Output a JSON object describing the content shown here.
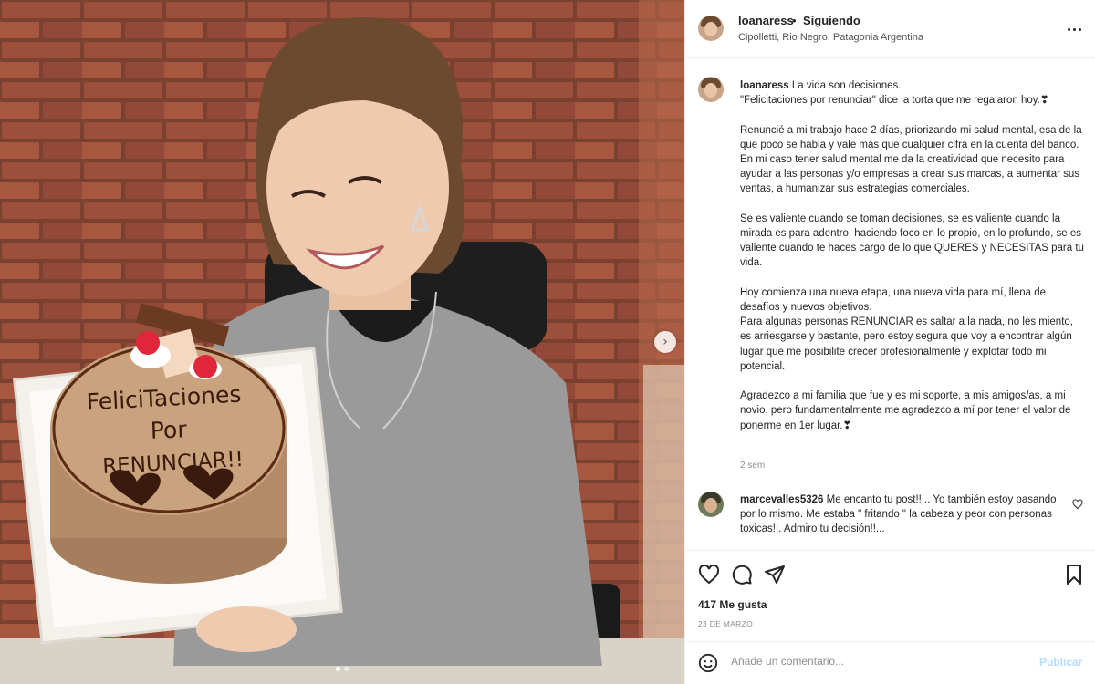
{
  "post": {
    "username": "loanaress",
    "separator": "•",
    "follow_status": "Siguiendo",
    "location": "Cipolletti, Rio Negro, Patagonia Argentina",
    "more_icon": "more-horizontal-icon"
  },
  "photo": {
    "cake_lines": [
      "FeliciTaciones",
      "Por",
      "RENUNCIAR!!"
    ],
    "next_icon": "chevron-right-icon",
    "carousel_count": 2,
    "carousel_active": 0
  },
  "caption": {
    "username": "loanaress",
    "lead": "La vida son decisiones.",
    "body": "\"Felicitaciones por renunciar\" dice la torta que me regalaron hoy.❣\n\nRenuncié a mi trabajo hace 2 días, priorizando mi salud mental, esa de la que poco se habla y vale más que cualquier cifra en la cuenta del banco.\nEn mi caso tener salud mental me da la creatividad que necesito para ayudar a las personas y/o empresas a crear sus marcas, a aumentar sus ventas, a humanizar sus estrategias comerciales.\n\nSe es valiente cuando se toman decisiones, se es valiente cuando la mirada es para adentro, haciendo foco en lo propio, en lo profundo, se es valiente cuando te haces cargo de lo que QUERES y NECESITAS para tu vida.\n\nHoy comienza una nueva etapa, una nueva vida para mí, llena de desafíos y nuevos objetivos.\nPara algunas personas RENUNCIAR es saltar a la nada, no les miento, es arriesgarse y bastante, pero estoy segura que voy a encontrar algún lugar que me posibilite crecer profesionalmente y explotar todo mi potencial.\n\nAgradezco a mi familia que fue y es mi soporte, a mis amigos/as, a mi novio, pero fundamentalmente me agradezco a mí por tener el valor de ponerme en 1er lugar.❣",
    "age": "2 sem"
  },
  "comment": {
    "username": "marcevalles5326",
    "text": "Me encanto tu post!!... Yo también estoy pasando por lo mismo. Me estaba \" fritando \" la cabeza y peor con personas toxicas!!. Admiro tu decisión!!..."
  },
  "actions": {
    "likes": "417 Me gusta",
    "date": "23 DE MARZO"
  },
  "add_comment": {
    "placeholder": "Añade un comentario...",
    "publish_label": "Publicar"
  },
  "colors": {
    "brick": "#9c4f3a",
    "sweater": "#9a9a9a",
    "cake": "#c9a27e",
    "publish": "#b3dbff"
  }
}
